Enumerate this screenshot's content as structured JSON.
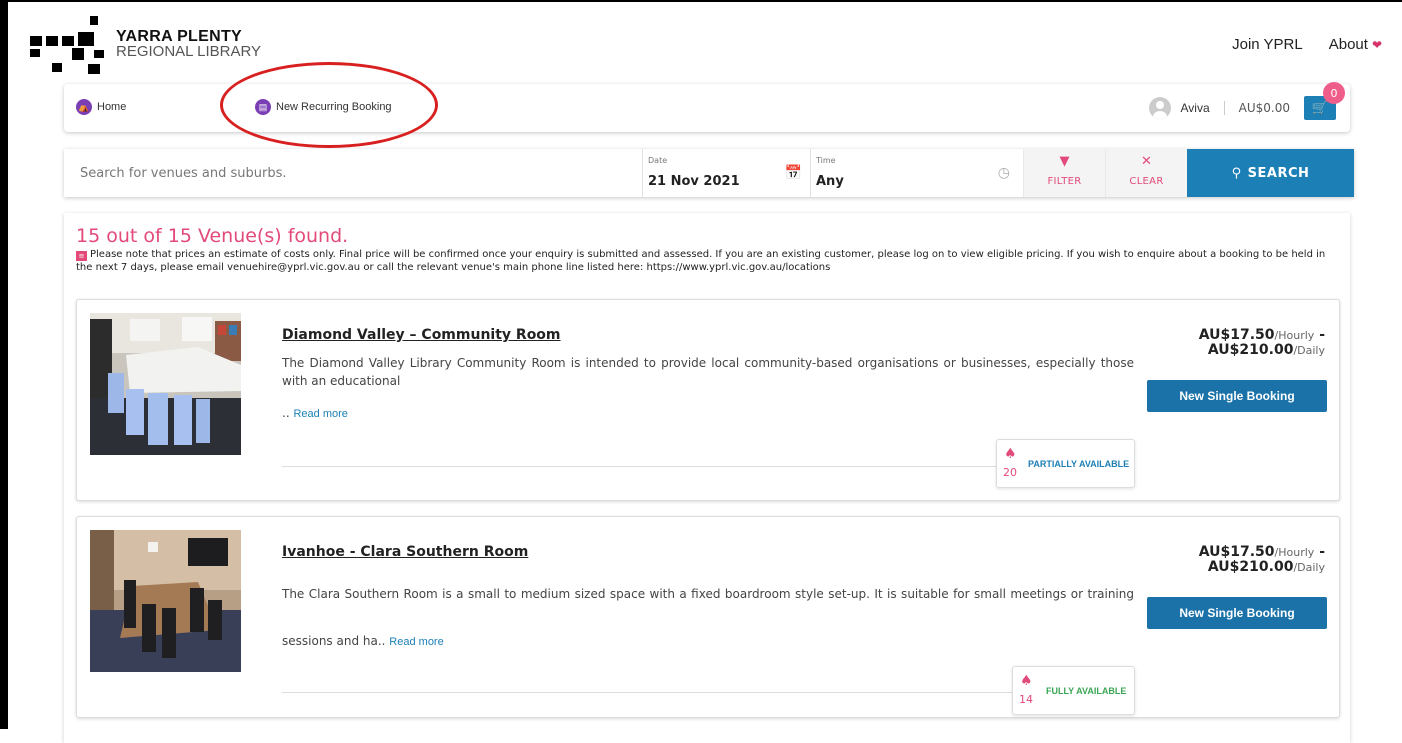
{
  "header": {
    "logo_line1": "YARRA PLENTY",
    "logo_line2": "REGIONAL LIBRARY",
    "nav": {
      "join": "Join YPRL",
      "about": "About"
    }
  },
  "breadcrumb": {
    "home": "Home",
    "current": "New Recurring Booking"
  },
  "user": {
    "name": "Aviva",
    "balance": "AU$0.00",
    "cart_count": "0"
  },
  "search": {
    "placeholder": "Search for venues and suburbs.",
    "date_label": "Date",
    "date_value": "21 Nov 2021",
    "time_label": "Time",
    "time_value": "Any",
    "filter_label": "FILTER",
    "clear_label": "CLEAR",
    "search_label": "SEARCH"
  },
  "results": {
    "title": "15 out of 15 Venue(s) found.",
    "note": "Please note that prices an estimate of costs only. Final price will be confirmed once your enquiry is submitted and assessed. If you are an existing customer, please log on to view eligible pricing. If you wish to enquire about a booking to be held in the next 7 days, please email venuehire@yprl.vic.gov.au or call the relevant venue's main phone line listed here: https://www.yprl.vic.gov.au/locations",
    "venues": [
      {
        "name": "Diamond Valley – Community Room",
        "description": "The Diamond Valley Library Community Room is intended to provide local community-based organisations or businesses, especially those with an educational",
        "ellipsis": "..",
        "read_more": "Read more",
        "capacity": "20",
        "availability": "PARTIALLY AVAILABLE",
        "price_hourly": "AU$17.50",
        "hourly_unit": "/Hourly",
        "price_separator": "-",
        "price_daily": "AU$210.00",
        "daily_unit": "/Daily",
        "button": "New Single Booking"
      },
      {
        "name": "Ivanhoe - Clara Southern Room",
        "description": "The Clara Southern Room is a small to medium sized space with a fixed boardroom style set-up. It is suitable for small meetings or training sessions and ha..",
        "read_more": "Read more",
        "capacity": "14",
        "availability": "FULLY AVAILABLE",
        "price_hourly": "AU$17.50",
        "hourly_unit": "/Hourly",
        "price_separator": "-",
        "price_daily": "AU$210.00",
        "daily_unit": "/Daily",
        "button": "New Single Booking"
      }
    ]
  },
  "colors": {
    "accent_pink": "#e24a7a",
    "primary_blue": "#1c7fb5",
    "partial_blue": "#1c7fb5",
    "full_green": "#3aa655",
    "annotation_red": "#d92020"
  }
}
